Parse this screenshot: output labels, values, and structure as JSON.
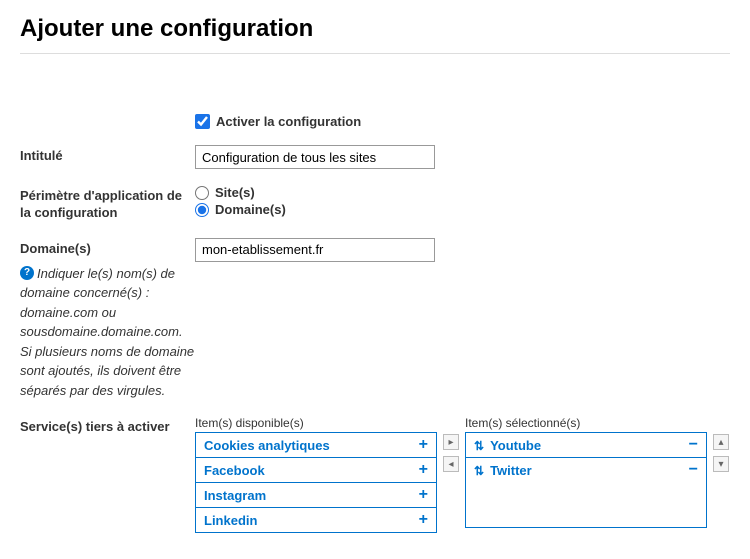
{
  "page": {
    "title": "Ajouter une configuration"
  },
  "activate": {
    "label": "Activer la configuration",
    "checked": true
  },
  "intitule": {
    "label": "Intitulé",
    "value": "Configuration de tous les sites"
  },
  "perimeter": {
    "label": "Périmètre d'application de la configuration",
    "options": {
      "site": "Site(s)",
      "domaine": "Domaine(s)"
    },
    "selected": "domaine"
  },
  "domaines": {
    "label": "Domaine(s)",
    "value": "mon-etablissement.fr",
    "help": "Indiquer le(s) nom(s) de domaine concerné(s) : domaine.com ou sousdomaine.domaine.com. Si plusieurs noms de domaine sont ajoutés, ils doivent être séparés par des virgules."
  },
  "services": {
    "label": "Service(s) tiers à activer",
    "available_title": "Item(s) disponible(s)",
    "selected_title": "Item(s) sélectionné(s)",
    "available": [
      "Cookies analytiques",
      "Facebook",
      "Instagram",
      "Linkedin"
    ],
    "selected": [
      "Youtube",
      "Twitter"
    ],
    "add_glyph": "+",
    "remove_glyph": "−",
    "sort_glyph": "⇅",
    "move_right": "▸",
    "move_left": "◂",
    "move_up": "▴",
    "move_down": "▾"
  }
}
